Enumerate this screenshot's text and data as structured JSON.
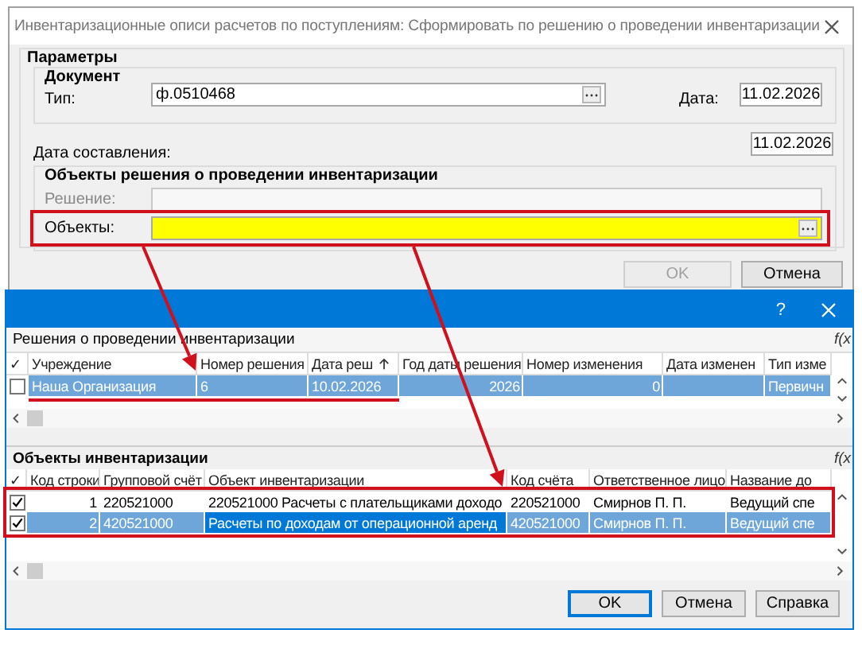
{
  "main_dialog": {
    "title": "Инвентаризационные описи расчетов по поступлениям: Сформировать по решению о проведении инвентаризации",
    "section_title": "Параметры",
    "document_group": {
      "title": "Документ",
      "type_label": "Тип:",
      "type_value": "ф.0510468",
      "date_label": "Дата:",
      "date_value": "11.02.2026"
    },
    "compile_date": {
      "label": "Дата составления:",
      "value": "11.02.2026"
    },
    "objects_group": {
      "title": "Объекты решения о проведении инвентаризации",
      "decision_label": "Решение:",
      "decision_disabled": true,
      "objects_label": "Объекты:",
      "objects_required": true
    },
    "buttons": [
      {
        "label": "OK",
        "disabled": true
      },
      {
        "label": "Отмена",
        "disabled": false
      }
    ]
  },
  "select_dialog": {
    "help": "?",
    "decisions": {
      "title": "Решения о проведении инвентаризации",
      "formula": "f(x",
      "check_header": "✓",
      "columns": [
        {
          "label": "Учреждение",
          "sorted": false
        },
        {
          "label": "Номер решения",
          "sorted": false
        },
        {
          "label": "Дата реш",
          "sorted": true
        },
        {
          "label": "Год даты решения",
          "sorted": false
        },
        {
          "label": "Номер изменения",
          "sorted": false
        },
        {
          "label": "Дата изменен",
          "sorted": false
        },
        {
          "label": "Тип изме",
          "sorted": false
        }
      ],
      "rows": [
        {
          "checked": false,
          "selected": true,
          "cells": [
            "Наша Организация",
            "6",
            "10.02.2026",
            "2026",
            "0",
            null,
            "Первичн"
          ]
        }
      ]
    },
    "objects": {
      "title": "Объекты инвентаризации",
      "formula": "f(x",
      "check_header": "✓",
      "columns": [
        {
          "label": "Код строки"
        },
        {
          "label": "Групповой счёт"
        },
        {
          "label": "Объект инвентаризации"
        },
        {
          "label": "Код счёта"
        },
        {
          "label": "Ответственное лицо"
        },
        {
          "label": "Название до"
        }
      ],
      "rows": [
        {
          "checked": true,
          "selected": false,
          "cells": [
            "1",
            "220521000",
            "220521000 Расчеты с плательщиками доходо",
            "220521000",
            "Смирнов П. П.",
            "Ведущий спе"
          ]
        },
        {
          "checked": true,
          "selected": true,
          "cells": [
            "2",
            "420521000",
            "Расчеты по доходам от операционной аренд",
            "420521000",
            "Смирнов П. П.",
            "Ведущий спе"
          ]
        }
      ]
    },
    "buttons": [
      {
        "label": "OK",
        "default": true
      },
      {
        "label": "Отмена",
        "default": false
      },
      {
        "label": "Справка",
        "default": false
      }
    ]
  }
}
